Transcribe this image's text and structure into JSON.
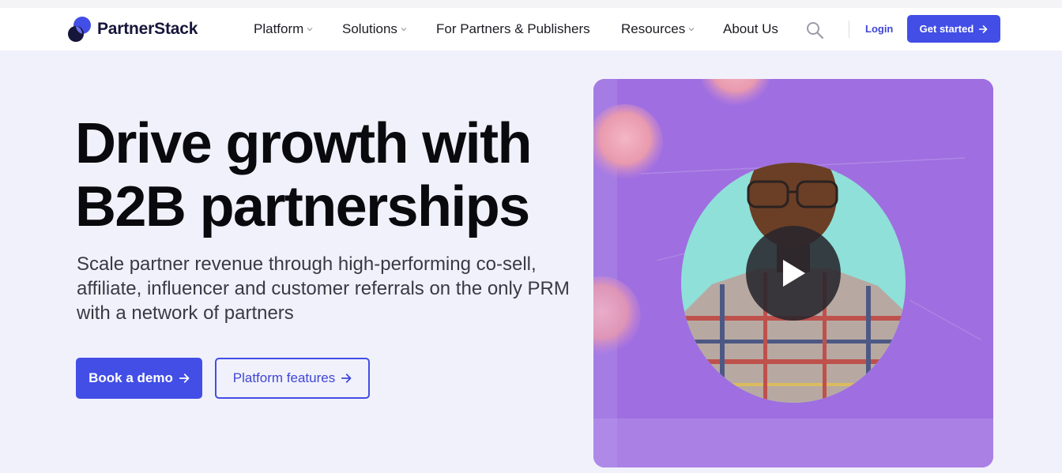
{
  "header": {
    "logo_text": "PartnerStack",
    "nav": [
      {
        "label": "Platform",
        "has_dropdown": true
      },
      {
        "label": "Solutions",
        "has_dropdown": true
      },
      {
        "label": "For Partners & Publishers",
        "has_dropdown": false
      },
      {
        "label": "Resources",
        "has_dropdown": true
      },
      {
        "label": "About Us",
        "has_dropdown": false
      }
    ],
    "search_icon": "search-icon",
    "login_label": "Login",
    "get_started_label": "Get started"
  },
  "hero": {
    "title_line1": "Drive growth with",
    "title_line2": "B2B partnerships",
    "subtitle": "Scale partner revenue through high-performing co-sell, affiliate, influencer and customer referrals on the only PRM with a network of partners",
    "primary_cta": "Book a demo",
    "secondary_cta": "Platform features"
  },
  "video": {
    "play_icon": "play-icon"
  },
  "colors": {
    "accent": "#424ee6",
    "page_bg": "#f1f1fb",
    "video_bg": "#9a6ae0",
    "teal_oval": "#8fe0d8"
  }
}
